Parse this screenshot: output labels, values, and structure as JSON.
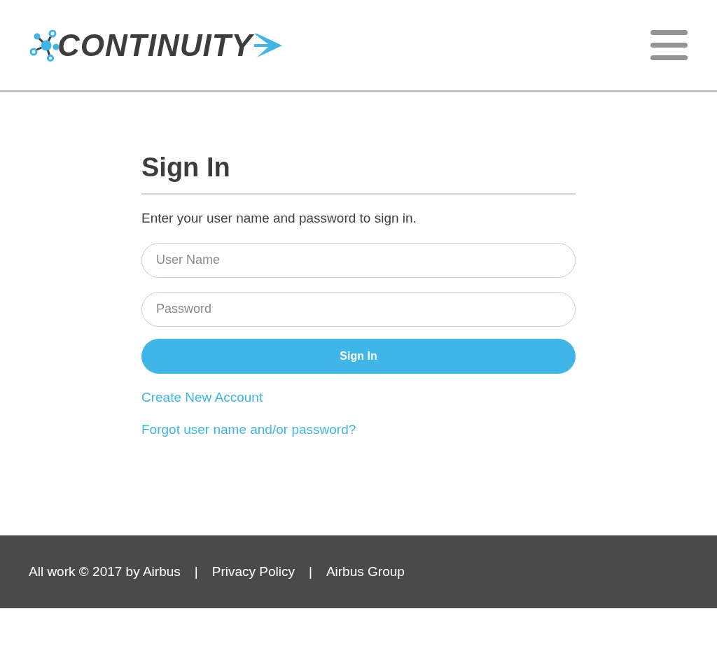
{
  "header": {
    "logo_text": "CONTINUITY"
  },
  "sign_in": {
    "title": "Sign In",
    "instructions": "Enter your user name and password to sign in.",
    "fields": [
      {
        "placeholder": "User Name"
      },
      {
        "placeholder": "Password"
      }
    ],
    "submit": "Sign In",
    "links": [
      "Create New Account",
      "Forgot user name and/or password?"
    ]
  },
  "footer": {
    "items": [
      {
        "kind": "text",
        "text": "All work © 2017 by Airbus"
      },
      {
        "kind": "separator",
        "text": "|"
      },
      {
        "kind": "link",
        "text": "Privacy Policy"
      },
      {
        "kind": "separator",
        "text": "|"
      },
      {
        "kind": "link",
        "text": "Airbus Group"
      }
    ]
  }
}
